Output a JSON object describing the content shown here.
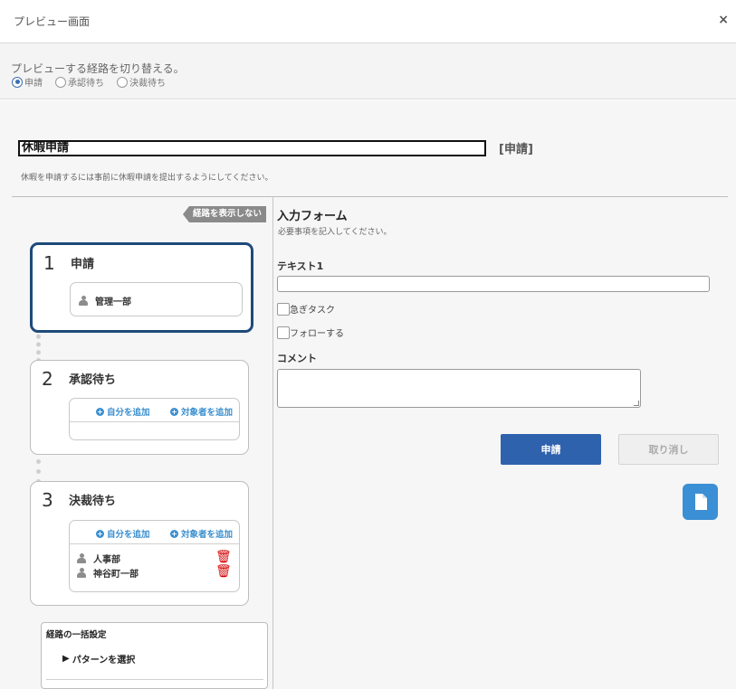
{
  "dialog": {
    "title": "プレビュー画面",
    "close": "×"
  },
  "switcher": {
    "label": "プレビューする経路を切り替える。",
    "options": [
      {
        "label": "申請",
        "selected": true
      },
      {
        "label": "承認待ち",
        "selected": false
      },
      {
        "label": "決裁待ち",
        "selected": false
      }
    ]
  },
  "form": {
    "title_value": "休暇申請",
    "title_tag": "[申請]",
    "description": "休暇を申請するには事前に休暇申請を提出するようにしてください。"
  },
  "route": {
    "toggle_label": "経路を表示しない",
    "add_self": "自分を追加",
    "add_target": "対象者を追加",
    "steps": [
      {
        "number": "1",
        "name": "申請",
        "assignees": [
          "管理一部"
        ]
      },
      {
        "number": "2",
        "name": "承認待ち",
        "assignees": []
      },
      {
        "number": "3",
        "name": "決裁待ち",
        "assignees": [
          "人事部",
          "神谷町一部"
        ]
      }
    ],
    "bulk": {
      "title": "経路の一括設定",
      "pattern": "パターンを選択"
    }
  },
  "input_form": {
    "title": "入力フォーム",
    "subtitle": "必要事項を記入してください。",
    "text_label": "テキスト1",
    "text_value": "",
    "checkbox_urgent": "急ぎタスク",
    "checkbox_follow": "フォローする",
    "comment_label": "コメント",
    "comment_value": "",
    "submit": "申請",
    "cancel": "取り消し"
  },
  "colors": {
    "primary": "#2f62ad",
    "active_border": "#1e4a7a",
    "link": "#3a8fd0",
    "delete": "#d40000",
    "doc_button": "#3b8fd4"
  }
}
